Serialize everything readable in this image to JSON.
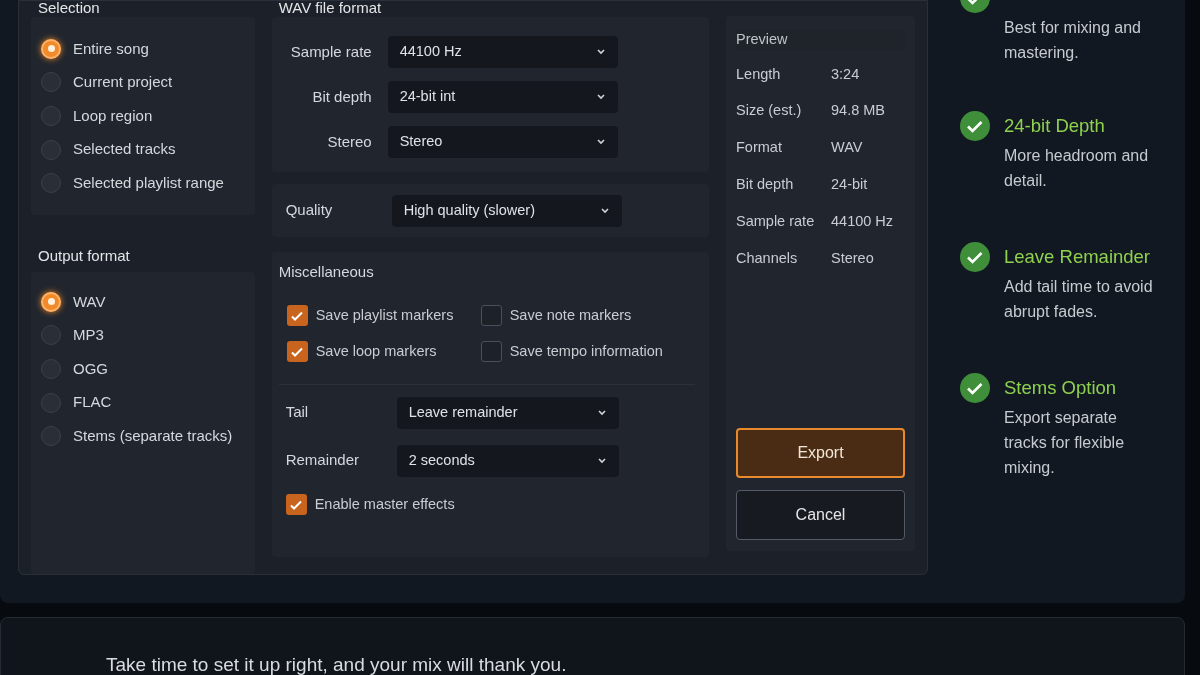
{
  "selection": {
    "label": "Selection",
    "options": [
      {
        "label": "Entire song",
        "selected": true
      },
      {
        "label": "Current project",
        "selected": false
      },
      {
        "label": "Loop region",
        "selected": false
      },
      {
        "label": "Selected tracks",
        "selected": false
      },
      {
        "label": "Selected playlist range",
        "selected": false
      }
    ]
  },
  "output_format": {
    "label": "Output format",
    "options": [
      {
        "label": "WAV",
        "selected": true
      },
      {
        "label": "MP3",
        "selected": false
      },
      {
        "label": "OGG",
        "selected": false
      },
      {
        "label": "FLAC",
        "selected": false
      },
      {
        "label": "Stems (separate tracks)",
        "selected": false
      }
    ]
  },
  "wav_format": {
    "label": "WAV file format",
    "fields": [
      {
        "label": "Sample rate",
        "value": "44100 Hz"
      },
      {
        "label": "Bit depth",
        "value": "24-bit int"
      },
      {
        "label": "Stereo",
        "value": "Stereo"
      }
    ]
  },
  "quality": {
    "label": "Quality",
    "value": "High quality (slower)"
  },
  "misc": {
    "label": "Miscellaneous",
    "checkboxes": [
      {
        "label": "Save playlist markers",
        "checked": true
      },
      {
        "label": "Save note markers",
        "checked": false
      },
      {
        "label": "Save loop markers",
        "checked": true
      },
      {
        "label": "Save tempo information",
        "checked": false
      }
    ],
    "fields": [
      {
        "label": "Tail",
        "value": "Leave remainder"
      },
      {
        "label": "Remainder",
        "value": "2 seconds"
      }
    ],
    "master": {
      "label": "Enable master effects",
      "checked": true
    }
  },
  "preview": {
    "title": "Preview",
    "rows": [
      {
        "label": "Length",
        "value": "3:24"
      },
      {
        "label": "Size (est.)",
        "value": "94.8 MB"
      },
      {
        "label": "Format",
        "value": "WAV"
      },
      {
        "label": "Bit depth",
        "value": "24-bit"
      },
      {
        "label": "Sample rate",
        "value": "44100 Hz"
      },
      {
        "label": "Channels",
        "value": "Stereo"
      }
    ]
  },
  "buttons": [
    {
      "label": "Export",
      "kind": "primary"
    },
    {
      "label": "Cancel",
      "kind": "secondary"
    }
  ],
  "tips": [
    {
      "text": "Best for mixing and mastering."
    },
    {
      "title": "24-bit Depth",
      "text": "More headroom and detail."
    },
    {
      "title": "Leave Remainder",
      "text": "Add tail time to avoid abrupt fades."
    },
    {
      "title": "Stems Option",
      "text": "Export separate tracks for flexible mixing."
    }
  ],
  "footer": "Take time to set it up right, and your mix will thank you."
}
